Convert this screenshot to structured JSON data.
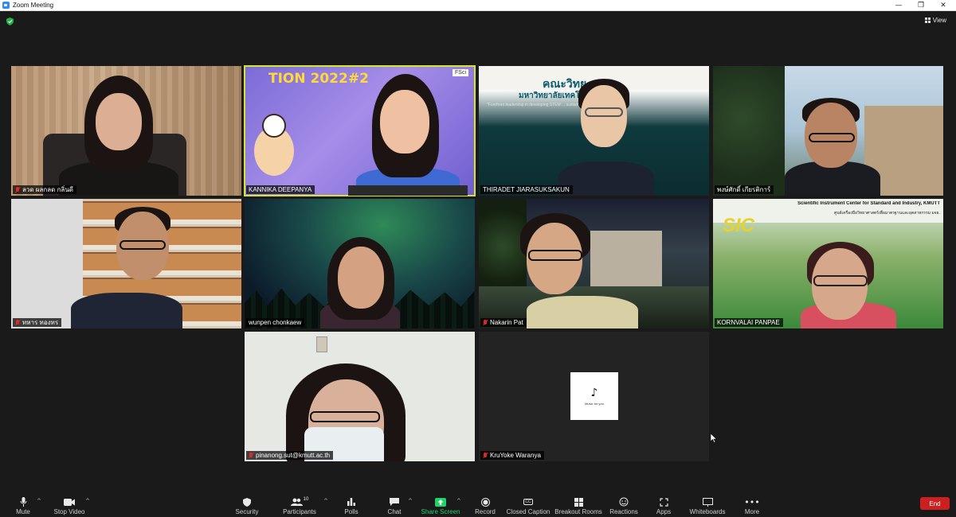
{
  "window": {
    "title": "Zoom Meeting"
  },
  "view": {
    "label": "View"
  },
  "participants": [
    {
      "name": "ลวด ผลกลด กลิ่นดี",
      "muted": true
    },
    {
      "name": "KANNIKA DEEPANYA",
      "muted": false,
      "active_speaker": true
    },
    {
      "name": "THIRADET JIARASUKSAKUN",
      "muted": false
    },
    {
      "name": "พงษ์ศักดิ์ เกียรติการ์",
      "muted": false
    },
    {
      "name": "ทหาร ทองทร",
      "muted": true
    },
    {
      "name": "wunpen chonkaew",
      "muted": false
    },
    {
      "name": "Nakarin Pat",
      "muted": true
    },
    {
      "name": "KORNVALAI PANPAE",
      "muted": false
    },
    {
      "name": "pinanong.sut@kmutt.ac.th",
      "muted": true
    },
    {
      "name": "KruYoke Waranya",
      "muted": true
    }
  ],
  "tile_content": {
    "kannika_banner": "TION 2022#2",
    "kannika_logo": "FSci",
    "thiradet_banner": "คณะวิทย",
    "thiradet_sub": "มหาวิทยาลัยเทคโนโลยี...ธนบุรี",
    "thiradet_tag": "\"Forefront leadership in developing STEM ... sustainable innovation\"",
    "kornvalai_title": "Scientific Instrument Center for Standard and Industry, KMUTT",
    "kornvalai_sub": "ศูนย์เครื่องมือวิทยาศาสตร์เพื่อมาตรฐานและอุตสาหกรรม มจธ.",
    "kornvalai_logo": "SIC",
    "kruyoke_avatar_text": "Music for you"
  },
  "toolbar": {
    "mute": "Mute",
    "stop_video": "Stop Video",
    "security": "Security",
    "participants": "Participants",
    "participants_count": "10",
    "polls": "Polls",
    "chat": "Chat",
    "share_screen": "Share Screen",
    "record": "Record",
    "closed_caption": "Closed Caption",
    "breakout_rooms": "Breakout Rooms",
    "reactions": "Reactions",
    "apps": "Apps",
    "whiteboards": "Whiteboards",
    "more": "More",
    "end": "End"
  },
  "colors": {
    "share_green": "#1fd36b",
    "end_red": "#cc2020",
    "active_speaker": "#d5e331",
    "mute_red": "#e02828"
  }
}
